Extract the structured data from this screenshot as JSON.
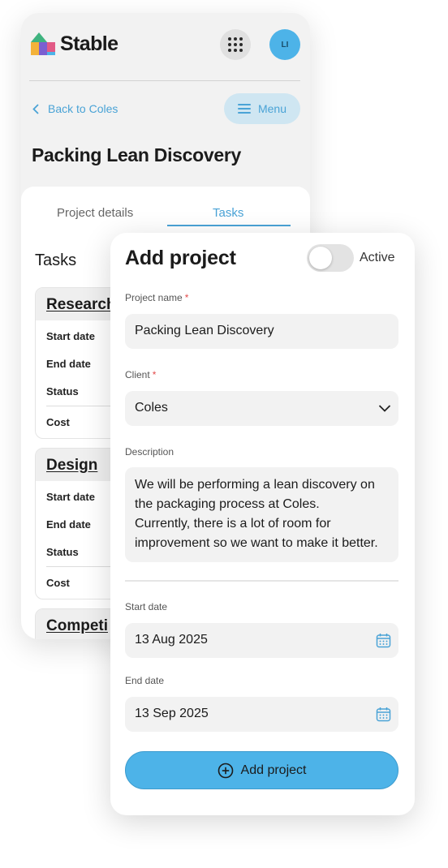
{
  "brand": {
    "name": "Stable"
  },
  "header": {
    "avatar_initials": "LI",
    "apps_icon": "grid-dots-icon"
  },
  "nav": {
    "back_label": "Back to Coles",
    "menu_label": "Menu"
  },
  "project": {
    "title": "Packing Lean Discovery"
  },
  "tabs": [
    {
      "label": "Project details",
      "active": false
    },
    {
      "label": "Tasks",
      "active": true
    }
  ],
  "tasks_section": {
    "title": "Tasks",
    "items": [
      {
        "name": "Research",
        "fields": [
          "Start date",
          "End date",
          "Status",
          "Cost"
        ]
      },
      {
        "name": "Design",
        "fields": [
          "Start date",
          "End date",
          "Status",
          "Cost"
        ]
      },
      {
        "name": "Competi"
      }
    ]
  },
  "form": {
    "title": "Add project",
    "active_toggle": {
      "label": "Active",
      "on": false
    },
    "project_name": {
      "label": "Project name",
      "required": "*",
      "value": "Packing Lean Discovery"
    },
    "client": {
      "label": "Client",
      "required": "*",
      "value": "Coles"
    },
    "description": {
      "label": "Description",
      "lines": [
        "We will be performing a lean discovery on",
        "the packaging process at Coles.",
        "Currently, there is a lot of room for",
        "improvement so we want to make it better."
      ]
    },
    "start_date": {
      "label": "Start date",
      "value": "13 Aug 2025"
    },
    "end_date": {
      "label": "End date",
      "value": "13 Sep 2025"
    },
    "submit_label": "Add project"
  },
  "colors": {
    "accent": "#4db3e8",
    "link": "#4aa3d6",
    "required": "#e34b4b"
  }
}
